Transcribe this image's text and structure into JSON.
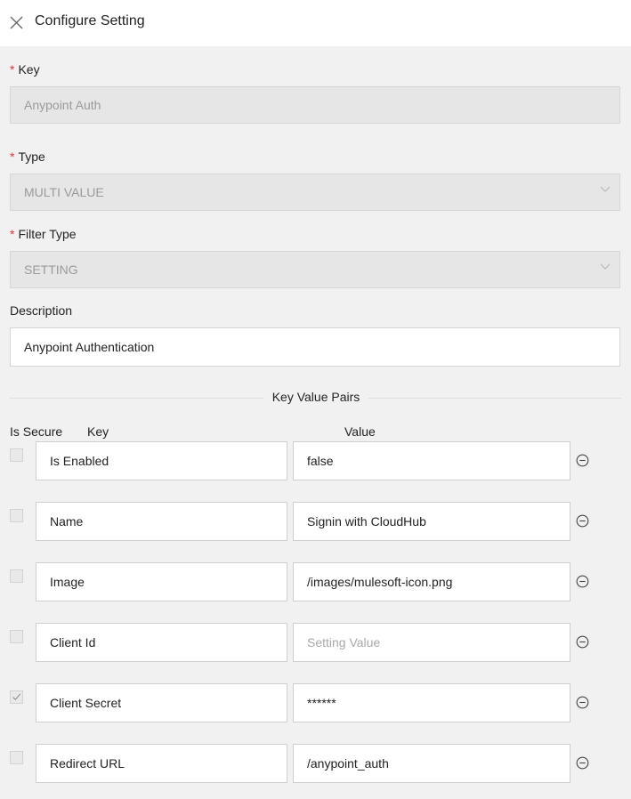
{
  "header": {
    "title": "Configure Setting",
    "close_icon": "close-icon"
  },
  "form": {
    "key": {
      "label": "Key",
      "required_mark": "*",
      "value": "Anypoint Auth"
    },
    "type": {
      "label": "Type",
      "required_mark": "*",
      "value": "MULTI VALUE"
    },
    "filter_type": {
      "label": "Filter Type",
      "required_mark": "*",
      "value": "SETTING"
    },
    "description": {
      "label": "Description",
      "value": "Anypoint Authentication"
    }
  },
  "kv": {
    "section_title": "Key Value Pairs",
    "headers": {
      "is_secure": "Is Secure",
      "key": "Key",
      "value": "Value"
    },
    "rows": [
      {
        "key": "Is Enabled",
        "value": "false",
        "secure": false
      },
      {
        "key": "Name",
        "value": "Signin with CloudHub",
        "secure": false
      },
      {
        "key": "Image",
        "value": "/images/mulesoft-icon.png",
        "secure": false
      },
      {
        "key": "Client Id",
        "value": "",
        "placeholder": "Setting Value",
        "secure": false
      },
      {
        "key": "Client Secret",
        "value": "******",
        "secure": true
      },
      {
        "key": "Redirect URL",
        "value": "/anypoint_auth",
        "secure": false
      }
    ]
  },
  "colors": {
    "required": "#e0343c",
    "disabled_bg": "#e6e6e6",
    "page_bg": "#f1f1f1"
  }
}
